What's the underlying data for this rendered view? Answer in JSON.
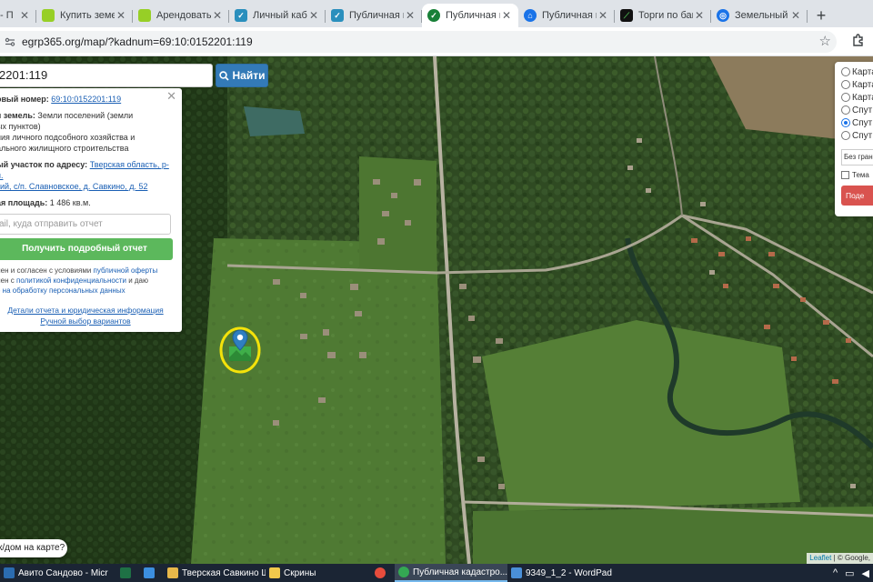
{
  "browser": {
    "tabs": [
      {
        "title": "- П",
        "favicon": "avito-icon",
        "color": "#00aaff"
      },
      {
        "title": "Купить земел",
        "favicon": "avito-icon",
        "color": "#97cf26"
      },
      {
        "title": "Арендовать з",
        "favicon": "avito-icon",
        "color": "#97cf26"
      },
      {
        "title": "Личный кабин",
        "favicon": "rosreestr-icon",
        "color": "#2a8fbd"
      },
      {
        "title": "Публичная ка",
        "favicon": "rosreestr-icon",
        "color": "#2a8fbd"
      },
      {
        "title": "Публичная ка",
        "favicon": "check-icon",
        "color": "#188038",
        "active": true
      },
      {
        "title": "Публичная ка",
        "favicon": "house-icon",
        "color": "#1a73e8"
      },
      {
        "title": "Торги по бан",
        "favicon": "torgi-icon",
        "color": "#1e8e3e"
      },
      {
        "title": "Земельный уч",
        "favicon": "globe-icon",
        "color": "#1a73e8"
      }
    ],
    "url": "egrp365.org/map/?kadnum=69:10:0152201:119"
  },
  "map": {
    "search": {
      "value": "2201:119",
      "button_label": "Найти"
    },
    "popup": {
      "cadastral_label": "овый номер:",
      "cadastral_value": "69:10:0152201:119",
      "land_label": "я земель:",
      "land_value_1": "Земли поселений (земли",
      "land_value_2": "ых пунктов)",
      "use_1": "ния личного подсобного хозяйства и",
      "use_2": "ального жилищного строительства",
      "address_label": "ый участок по адресу:",
      "address_1": "Тверская область, р-н.",
      "address_2": "кий, с/п. Славновское, д. Савкино, д. 52",
      "area_label": "ая площадь:",
      "area_value": "1 486 кв.м.",
      "email_placeholder": "ail, куда отправить отчет",
      "report_button": "Получить подробный отчет",
      "consent_1a": "лен и согласен с условиями ",
      "consent_1b": "публичной оферты",
      "consent_2a": "лен с ",
      "consent_2b": "политикой конфиденциальности",
      "consent_2c": " и даю",
      "consent_3": "е на обработку персональных данных",
      "details_link": "Детали отчета и юридическая информация",
      "manual_link": "Ручной выбор вариантов"
    },
    "layers": {
      "options": [
        {
          "label": "Карта",
          "checked": false
        },
        {
          "label": "Карта",
          "checked": false
        },
        {
          "label": "Карта",
          "checked": false
        },
        {
          "label": "Спут",
          "checked": false
        },
        {
          "label": "Спут",
          "checked": true
        },
        {
          "label": "Спут",
          "checked": false
        }
      ],
      "select_value": "Без грани",
      "theme_label": "Тема",
      "submit_label": "Поде"
    },
    "help_text": "к/дом на карте?",
    "attribution_leaflet": "Leaflet",
    "attribution_rest": " | © Google, "
  },
  "taskbar": {
    "items": [
      {
        "label": "Авито Сандово - Micr",
        "color": "#2b6cb0"
      },
      {
        "label": "",
        "color": "#1e7145"
      },
      {
        "label": "",
        "color": "#3c8fe0"
      },
      {
        "label": "Тверская Савкино Ш...",
        "color": "#e8b84a"
      },
      {
        "label": "Скрины",
        "color": "#f2c94c"
      },
      {
        "label": "",
        "color": "#e74c3c"
      },
      {
        "label": "Публичная кадастро...",
        "color": "#34a853",
        "active": true
      },
      {
        "label": "9349_1_2 - WordPad",
        "color": "#4a90d9"
      }
    ],
    "tray_text": "^"
  }
}
